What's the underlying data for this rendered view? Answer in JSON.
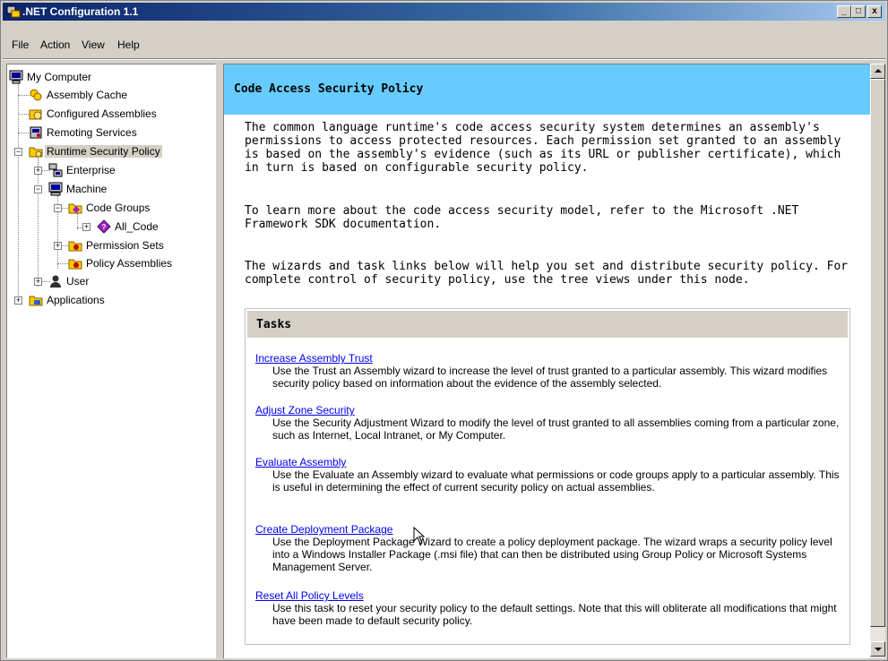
{
  "window": {
    "title": ".NET Configuration 1.1"
  },
  "titlebar_buttons": {
    "minimize": "_",
    "maximize": "□",
    "close": "x"
  },
  "menu": [
    "File",
    "Action",
    "View",
    "Help"
  ],
  "tree": [
    {
      "label": "My Computer",
      "icon": "computer-icon"
    },
    {
      "label": "Assembly Cache",
      "icon": "assembly-cache-icon"
    },
    {
      "label": "Configured Assemblies",
      "icon": "configured-assemblies-icon"
    },
    {
      "label": "Remoting Services",
      "icon": "remoting-services-icon"
    },
    {
      "label": "Runtime Security Policy",
      "icon": "folder-icon",
      "selected": true
    },
    {
      "label": "Enterprise",
      "icon": "enterprise-icon"
    },
    {
      "label": "Machine",
      "icon": "machine-icon"
    },
    {
      "label": "Code Groups",
      "icon": "folder-icon"
    },
    {
      "label": "All_Code",
      "icon": "code-group-icon"
    },
    {
      "label": "Permission Sets",
      "icon": "permission-sets-icon"
    },
    {
      "label": "Policy Assemblies",
      "icon": "policy-assemblies-icon"
    },
    {
      "label": "User",
      "icon": "user-icon"
    },
    {
      "label": "Applications",
      "icon": "applications-icon"
    }
  ],
  "content": {
    "heading": "Code Access Security Policy",
    "paragraphs": [
      "The common language runtime's code access security system determines an assembly's permissions to access protected resources.  Each permission set granted to an assembly is based on the assembly's evidence (such as its URL or publisher certificate), which in turn is based on configurable security policy.",
      "To learn more about the code access security model, refer to the Microsoft .NET Framework SDK documentation.",
      "The wizards and task links below will help you set and distribute security policy.  For complete control of security policy, use the tree views under this node."
    ],
    "tasks_heading": "Tasks",
    "tasks": [
      {
        "link": "Increase Assembly Trust",
        "desc": "Use the Trust an Assembly wizard to increase the level of trust granted to a particular assembly. This wizard modifies security policy based on information about the evidence of the assembly selected."
      },
      {
        "link": "Adjust Zone Security",
        "desc": "Use the Security Adjustment Wizard to modify the level of trust granted to all assemblies coming from a particular zone, such as Internet, Local Intranet, or My Computer."
      },
      {
        "link": "Evaluate Assembly",
        "desc": "Use the Evaluate an Assembly wizard to evaluate what permissions or code groups apply to a particular assembly. This is useful in determining the effect of current security policy on actual assemblies."
      },
      {
        "link": "Create Deployment Package",
        "desc": "Use the Deployment Package Wizard to create a policy deployment package. The wizard wraps a security policy level into a Windows Installer Package (.msi file) that can then be distributed using Group Policy or Microsoft Systems Management Server."
      },
      {
        "link": "Reset All Policy Levels",
        "desc": "Use this task to reset your security policy to the default settings. Note that this will obliterate all modifications that might have been made to default security policy."
      }
    ]
  },
  "colors": {
    "header_bg": "#66ccff",
    "link": "#0000ee",
    "titlebar": "#0a246a"
  }
}
